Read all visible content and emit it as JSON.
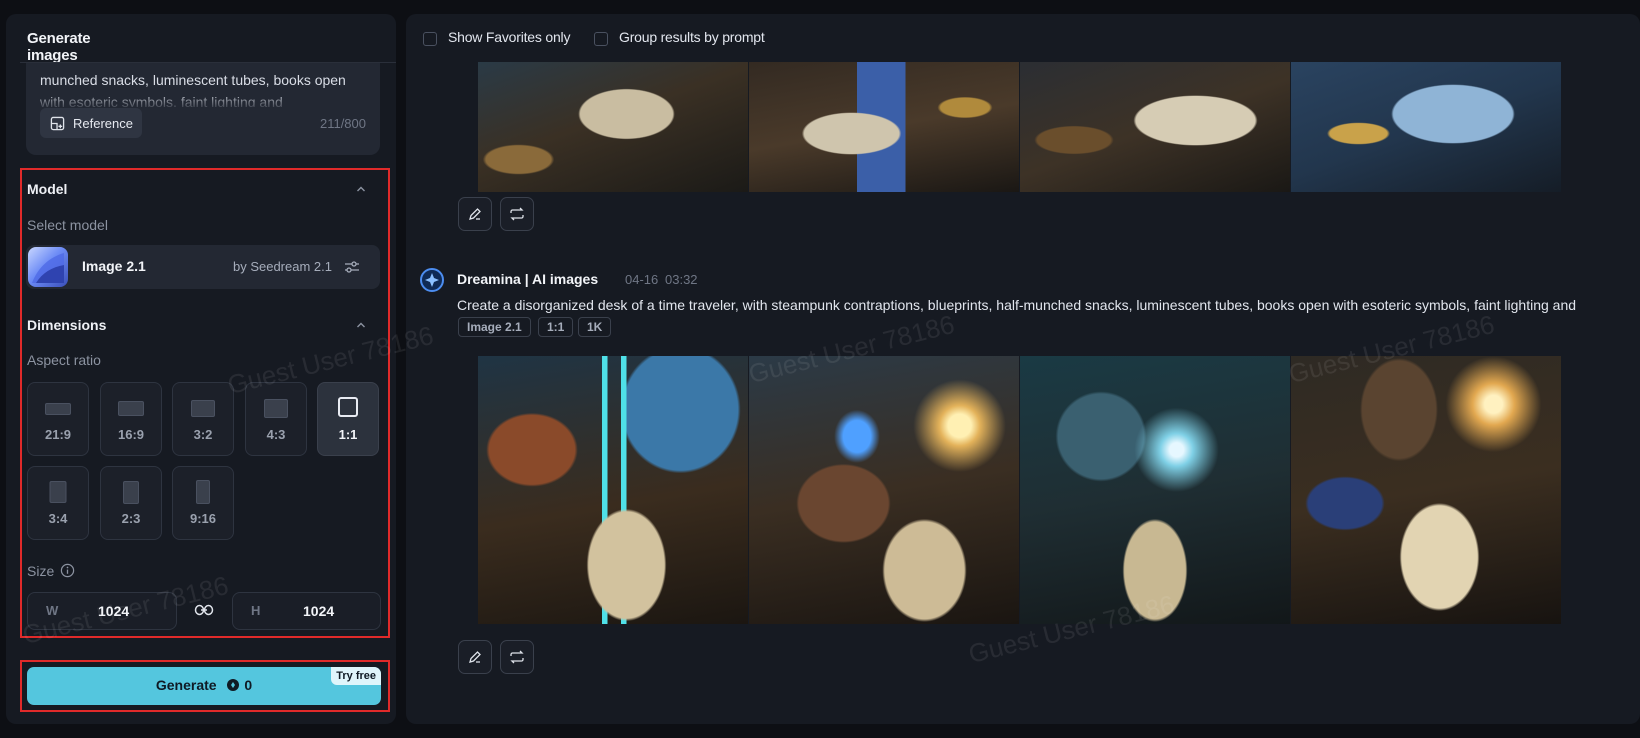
{
  "sidebar": {
    "tab_label": "Generate images",
    "prompt_preview": "munched snacks, luminescent tubes, books open with esoteric symbols, faint lighting and",
    "reference_label": "Reference",
    "char_counter": "211/800",
    "model": {
      "title": "Model",
      "subtitle": "Select model",
      "name": "Image 2.1",
      "by": "by Seedream 2.1"
    },
    "dimensions": {
      "title": "Dimensions",
      "aspect_label": "Aspect ratio",
      "ratios": [
        {
          "label": "21:9",
          "selected": false
        },
        {
          "label": "16:9",
          "selected": false
        },
        {
          "label": "3:2",
          "selected": false
        },
        {
          "label": "4:3",
          "selected": false
        },
        {
          "label": "1:1",
          "selected": true
        },
        {
          "label": "3:4",
          "selected": false
        },
        {
          "label": "2:3",
          "selected": false
        },
        {
          "label": "9:16",
          "selected": false
        }
      ],
      "size_label": "Size",
      "width_key": "W",
      "width_value": "1024",
      "height_key": "H",
      "height_value": "1024"
    },
    "generate": {
      "label": "Generate",
      "cost": "0",
      "badge": "Try free"
    }
  },
  "filters": {
    "favorites_label": "Show Favorites only",
    "group_label": "Group results by prompt"
  },
  "results": [
    {
      "author": "",
      "date": "",
      "time": ""
    },
    {
      "author": "Dreamina | AI images",
      "date": "04-16",
      "time": "03:32",
      "prompt": "Create a disorganized desk of a time traveler, with steampunk contraptions, blueprints, half-munched snacks, luminescent tubes, books open with esoteric symbols, faint lighting and",
      "tags": [
        "Image 2.1",
        "1:1",
        "1K"
      ]
    }
  ],
  "watermark": "Guest User 78186",
  "colors": {
    "accent": "#54c6de",
    "highlight_border": "#e02a2a",
    "panel": "#161a22",
    "background": "#0d0f14"
  }
}
